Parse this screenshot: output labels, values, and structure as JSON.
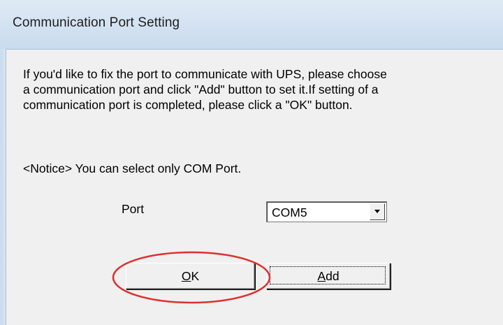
{
  "window": {
    "title": "Communication Port Setting"
  },
  "dialog": {
    "description_line1": "If you'd like to fix the port to communicate with UPS, please choose",
    "description_line2": "a communication port and click \"Add\" button to set it.If setting of a",
    "description_line3": "communication port is completed, please click a \"OK\" button.",
    "notice": "<Notice> You can select only COM Port.",
    "port_label": "Port",
    "port_selected": "COM5",
    "ok_mnemonic": "O",
    "ok_rest": "K",
    "add_mnemonic": "A",
    "add_rest": "dd"
  },
  "colors": {
    "highlight_circle": "#e03030",
    "titlebar": "#c9dbee",
    "client_bg": "#f0f0f0"
  },
  "icons": {
    "dropdown": "chevron-down-icon"
  }
}
